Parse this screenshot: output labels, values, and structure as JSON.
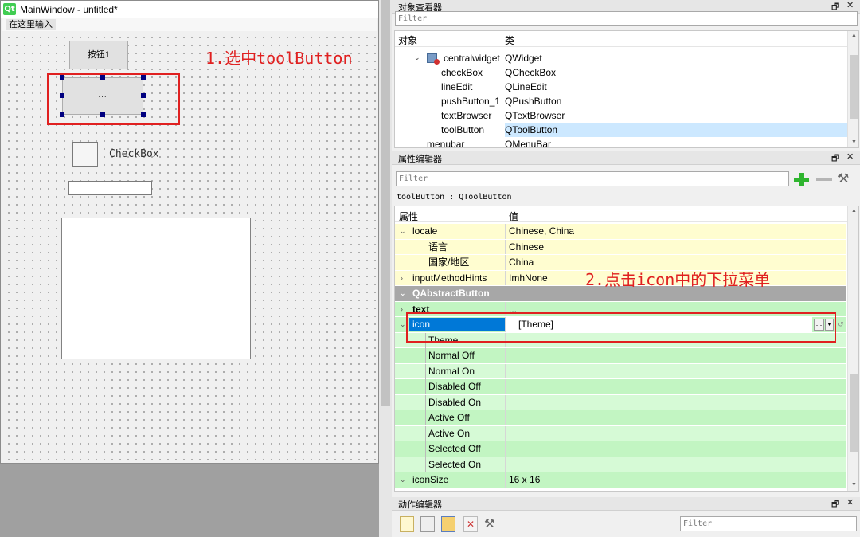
{
  "main_window": {
    "title": "MainWindow - untitled*",
    "logo": "Qt",
    "menu_placeholder": "在这里输入",
    "push_button_label": "按钮1",
    "tool_button_label": "...",
    "checkbox_label": "CheckBox",
    "annotation": "1.选中toolButton"
  },
  "object_inspector": {
    "title": "对象查看器",
    "filter_placeholder": "Filter",
    "columns": [
      "对象",
      "类"
    ],
    "rows": [
      {
        "name": "centralwidget",
        "class": "QWidget"
      },
      {
        "name": "checkBox",
        "class": "QCheckBox"
      },
      {
        "name": "lineEdit",
        "class": "QLineEdit"
      },
      {
        "name": "pushButton_1",
        "class": "QPushButton"
      },
      {
        "name": "textBrowser",
        "class": "QTextBrowser"
      },
      {
        "name": "toolButton",
        "class": "QToolButton"
      },
      {
        "name": "menubar",
        "class": "QMenuBar"
      }
    ],
    "selected_row": "toolButton"
  },
  "property_editor": {
    "title": "属性编辑器",
    "filter_placeholder": "Filter",
    "object_label": "toolButton : QToolButton",
    "columns": [
      "属性",
      "值"
    ],
    "rows": [
      {
        "name": "locale",
        "value": "Chinese, China"
      },
      {
        "name": "语言",
        "value": "Chinese"
      },
      {
        "name": "国家/地区",
        "value": "China"
      },
      {
        "name": "inputMethodHints",
        "value": "ImhNone"
      },
      {
        "name": "QAbstractButton",
        "value": ""
      },
      {
        "name": "text",
        "value": "..."
      },
      {
        "name": "icon",
        "value": "[Theme]"
      },
      {
        "name": "Theme",
        "value": ""
      },
      {
        "name": "Normal Off",
        "value": ""
      },
      {
        "name": "Normal On",
        "value": ""
      },
      {
        "name": "Disabled Off",
        "value": ""
      },
      {
        "name": "Disabled On",
        "value": ""
      },
      {
        "name": "Active Off",
        "value": ""
      },
      {
        "name": "Active On",
        "value": ""
      },
      {
        "name": "Selected Off",
        "value": ""
      },
      {
        "name": "Selected On",
        "value": ""
      },
      {
        "name": "iconSize",
        "value": "16 x 16"
      }
    ],
    "icon_browse_label": "...",
    "annotation": "2.点击icon中的下拉菜单"
  },
  "action_editor": {
    "title": "动作编辑器",
    "filter_placeholder": "Filter"
  },
  "dock_controls": {
    "float": "🗗",
    "close": "✕"
  },
  "colors": {
    "annotation_red": "#e02020",
    "selection_blue": "#0078d7",
    "row_yellow": "#fffdd0",
    "row_green": "#c2f5c2",
    "section_grey": "#a7a7a7"
  }
}
